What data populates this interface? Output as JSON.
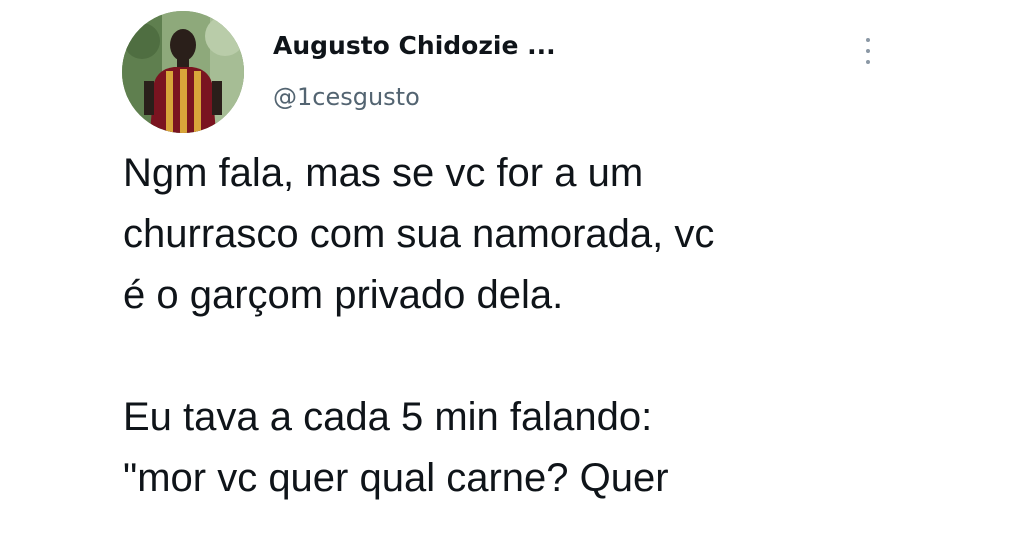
{
  "tweet": {
    "author": {
      "display_name": "Augusto Chidozie ...",
      "handle": "@1cesgusto",
      "avatar_icon": "person-photo-avatar"
    },
    "menu_icon": "more-vertical-icon",
    "text_lines": [
      "Ngm fala, mas se vc for a um",
      "churrasco com sua namorada, vc",
      "é o garçom privado dela.",
      "",
      "Eu tava a cada 5 min falando:",
      "\"mor vc quer qual carne? Quer"
    ]
  }
}
